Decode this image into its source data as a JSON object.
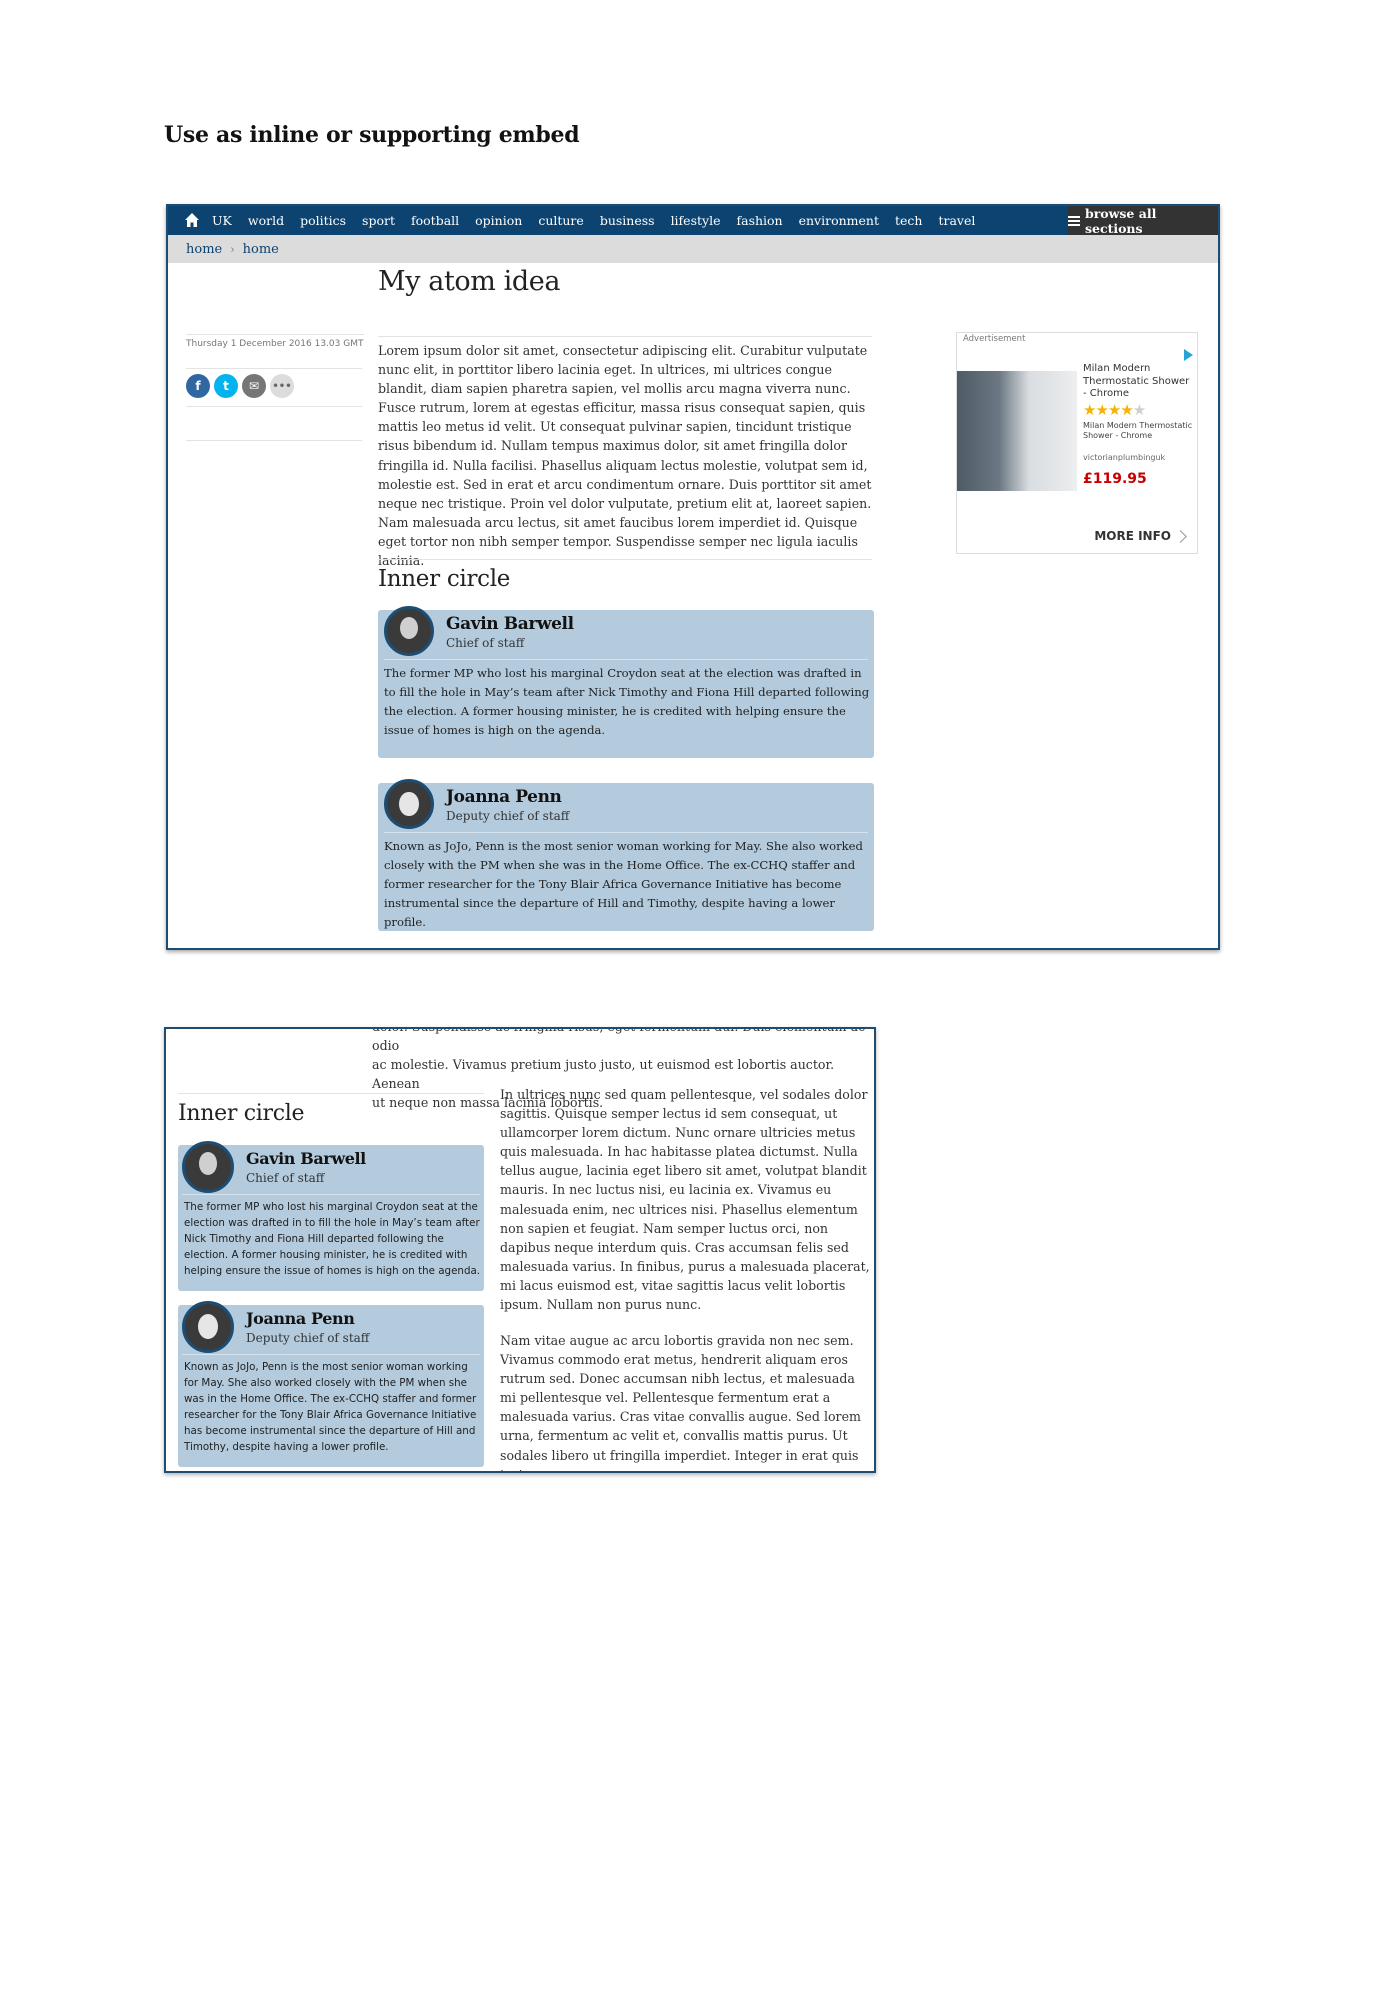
{
  "page": {
    "heading": "Use as inline or supporting embed"
  },
  "nav": {
    "items": [
      "UK",
      "world",
      "politics",
      "sport",
      "football",
      "opinion",
      "culture",
      "business",
      "lifestyle",
      "fashion",
      "environment",
      "tech",
      "travel"
    ],
    "browse_label": "browse all sections"
  },
  "breadcrumbs": [
    "home",
    "home"
  ],
  "article": {
    "title": "My atom idea",
    "date": "Thursday 1 December 2016 13.03 GMT",
    "body": "Lorem ipsum dolor sit amet, consectetur adipiscing elit. Curabitur vulputate nunc elit, in porttitor libero lacinia eget. In ultrices, mi ultrices congue blandit, diam sapien pharetra sapien, vel mollis arcu magna viverra nunc. Fusce rutrum, lorem at egestas efficitur, massa risus consequat sapien, quis mattis leo metus id velit. Ut consequat pulvinar sapien, tincidunt tristique risus bibendum id. Nullam tempus maximus dolor, sit amet fringilla dolor fringilla id. Nulla facilisi. Phasellus aliquam lectus molestie, volutpat sem id, molestie est. Sed in erat et arcu condimentum ornare. Duis porttitor sit amet neque nec tristique. Proin vel dolor vulputate, pretium elit at, laoreet sapien. Nam malesuada arcu lectus, sit amet faucibus lorem imperdiet id. Quisque eget tortor non nibh semper tempor. Suspendisse semper nec ligula iaculis lacinia."
  },
  "share": {
    "facebook": "f",
    "twitter": "t",
    "email": "✉",
    "more": "•••"
  },
  "inner_circle": {
    "heading": "Inner circle",
    "people": [
      {
        "name": "Gavin Barwell",
        "role": "Chief of staff",
        "desc": "The former MP who lost his marginal Croydon seat at the election was drafted in to fill the hole in May’s team after Nick Timothy and Fiona Hill departed following the election. A former housing minister, he is credited with helping ensure the issue of homes is high on the agenda."
      },
      {
        "name": "Joanna Penn",
        "role": "Deputy chief of staff",
        "desc": "Known as JoJo, Penn is the most senior woman working for May. She also worked closely with the PM when she was in the Home Office. The ex-CCHQ staffer and former researcher for the Tony Blair Africa Governance Initiative has become instrumental since the departure of Hill and Timothy, despite having a lower profile."
      }
    ]
  },
  "ad": {
    "label": "Advertisement",
    "title": "Milan Modern Thermostatic Shower - Chrome",
    "stars": "★★★★",
    "star_empty": "★",
    "subtitle": "Milan Modern Thermostatic Shower - Chrome",
    "domain": "victorianplumbinguk",
    "price": "£119.95",
    "more_info": "MORE INFO"
  },
  "frame2": {
    "top_text_line1": "dolor. Suspendisse ac fringilla risus, eget fermentum dui. Duis elementum ac odio",
    "top_text_line2": "ac molestie. Vivamus pretium justo justo, ut euismod est lobortis auctor. Aenean",
    "top_text_line3": "ut neque non massa lacinia lobortis.",
    "para1": "In ultrices nunc sed quam pellentesque, vel sodales dolor sagittis. Quisque semper lectus id sem consequat, ut ullamcorper lorem dictum. Nunc ornare ultricies metus quis malesuada. In hac habitasse platea dictumst. Nulla tellus augue, lacinia eget libero sit amet, volutpat blandit mauris. In nec luctus nisi, eu lacinia ex. Vivamus eu malesuada enim, nec ultrices nisi. Phasellus elementum non sapien et feugiat. Nam semper luctus orci, non dapibus neque interdum quis. Cras accumsan felis sed malesuada varius. In finibus, purus a malesuada placerat, mi lacus euismod est, vitae sagittis lacus velit lobortis ipsum. Nullam non purus nunc.",
    "para2": "Nam vitae augue ac arcu lobortis gravida non nec sem. Vivamus commodo erat metus, hendrerit aliquam eros rutrum sed. Donec accumsan nibh lectus, et malesuada mi pellentesque vel. Pellentesque fermentum erat a malesuada varius. Cras vitae convallis augue. Sed lorem urna, fermentum ac velit et, convallis mattis purus. Ut sodales libero ut fringilla imperdiet. Integer in erat quis tortor"
  },
  "colors": {
    "nav_bg": "#0c4371",
    "card_bg": "#b3cbdd",
    "price": "#c70000"
  }
}
